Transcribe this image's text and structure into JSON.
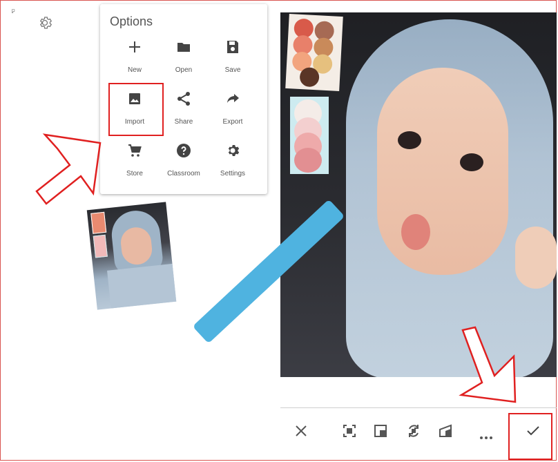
{
  "panel": {
    "title": "Options",
    "items": [
      {
        "label": "New",
        "icon": "plus-icon"
      },
      {
        "label": "Open",
        "icon": "folder-icon"
      },
      {
        "label": "Save",
        "icon": "save-icon"
      },
      {
        "label": "Import",
        "icon": "image-icon"
      },
      {
        "label": "Share",
        "icon": "share-icon"
      },
      {
        "label": "Export",
        "icon": "export-arrow-icon"
      },
      {
        "label": "Store",
        "icon": "cart-icon"
      },
      {
        "label": "Classroom",
        "icon": "help-icon"
      },
      {
        "label": "Settings",
        "icon": "settings-icon"
      }
    ]
  },
  "toolbar": {
    "icons": [
      "close-icon",
      "fit-screen-icon",
      "crop-icon",
      "rotate-icon",
      "perspective-icon",
      "more-icon",
      "check-icon"
    ]
  },
  "colors": {
    "highlight": "#e02020",
    "accent_bar": "#4fb3e0",
    "icon": "#555555"
  }
}
